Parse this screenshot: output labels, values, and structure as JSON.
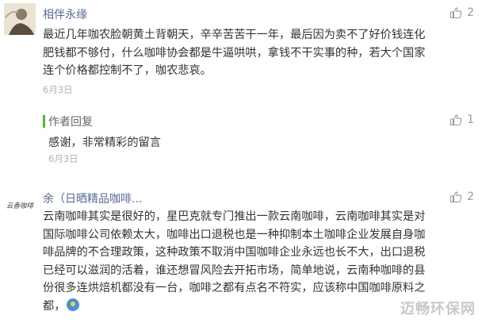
{
  "comments": [
    {
      "nickname": "相伴永缘",
      "likes": "2",
      "lines": [
        "最近几年咖农脸朝黄土背朝天，辛辛苦苦干一年，最后因为卖不了好价钱连化",
        "肥钱都不够付，什么咖啡协会都是牛逼哄哄，拿钱不干实事的种，若大个国家",
        "连个价格都控制不了，咖农悲哀。"
      ],
      "date": "6月3日",
      "reply": {
        "label": "作者回复",
        "likes": "1",
        "text": "感谢，非常精彩的留言",
        "date": "6月3日"
      }
    },
    {
      "nickname": "余（日晒精品咖啡...",
      "likes": "2",
      "avatar_text": "云香咖啡",
      "lines": [
        "云南咖啡其实是很好的，星巴克就专门推出一款云南咖啡，云南咖啡其实是对",
        "国际咖啡公司依赖太大，咖啡出口退税也是一种抑制本土咖啡企业发展自身咖",
        "啡品牌的不合理政策，这种政策不取消中国咖啡企业永远也长不大，出口退税",
        "已经可以滋润的活着，谁还想冒风险去开拓市场，简单地说，云南种咖啡的县",
        "份很多连烘焙机都没有一台，咖啡之都有点名不符实，应该称中国咖啡原料之",
        "都，"
      ]
    }
  ],
  "watermark": "迈畅环保网",
  "colors": {
    "nickname": "#576b95",
    "reply_bar": "#58b536",
    "date": "#b2b2b2"
  },
  "icons": {
    "like": "thumbs-up-icon",
    "emoji": "emoji-icon"
  }
}
